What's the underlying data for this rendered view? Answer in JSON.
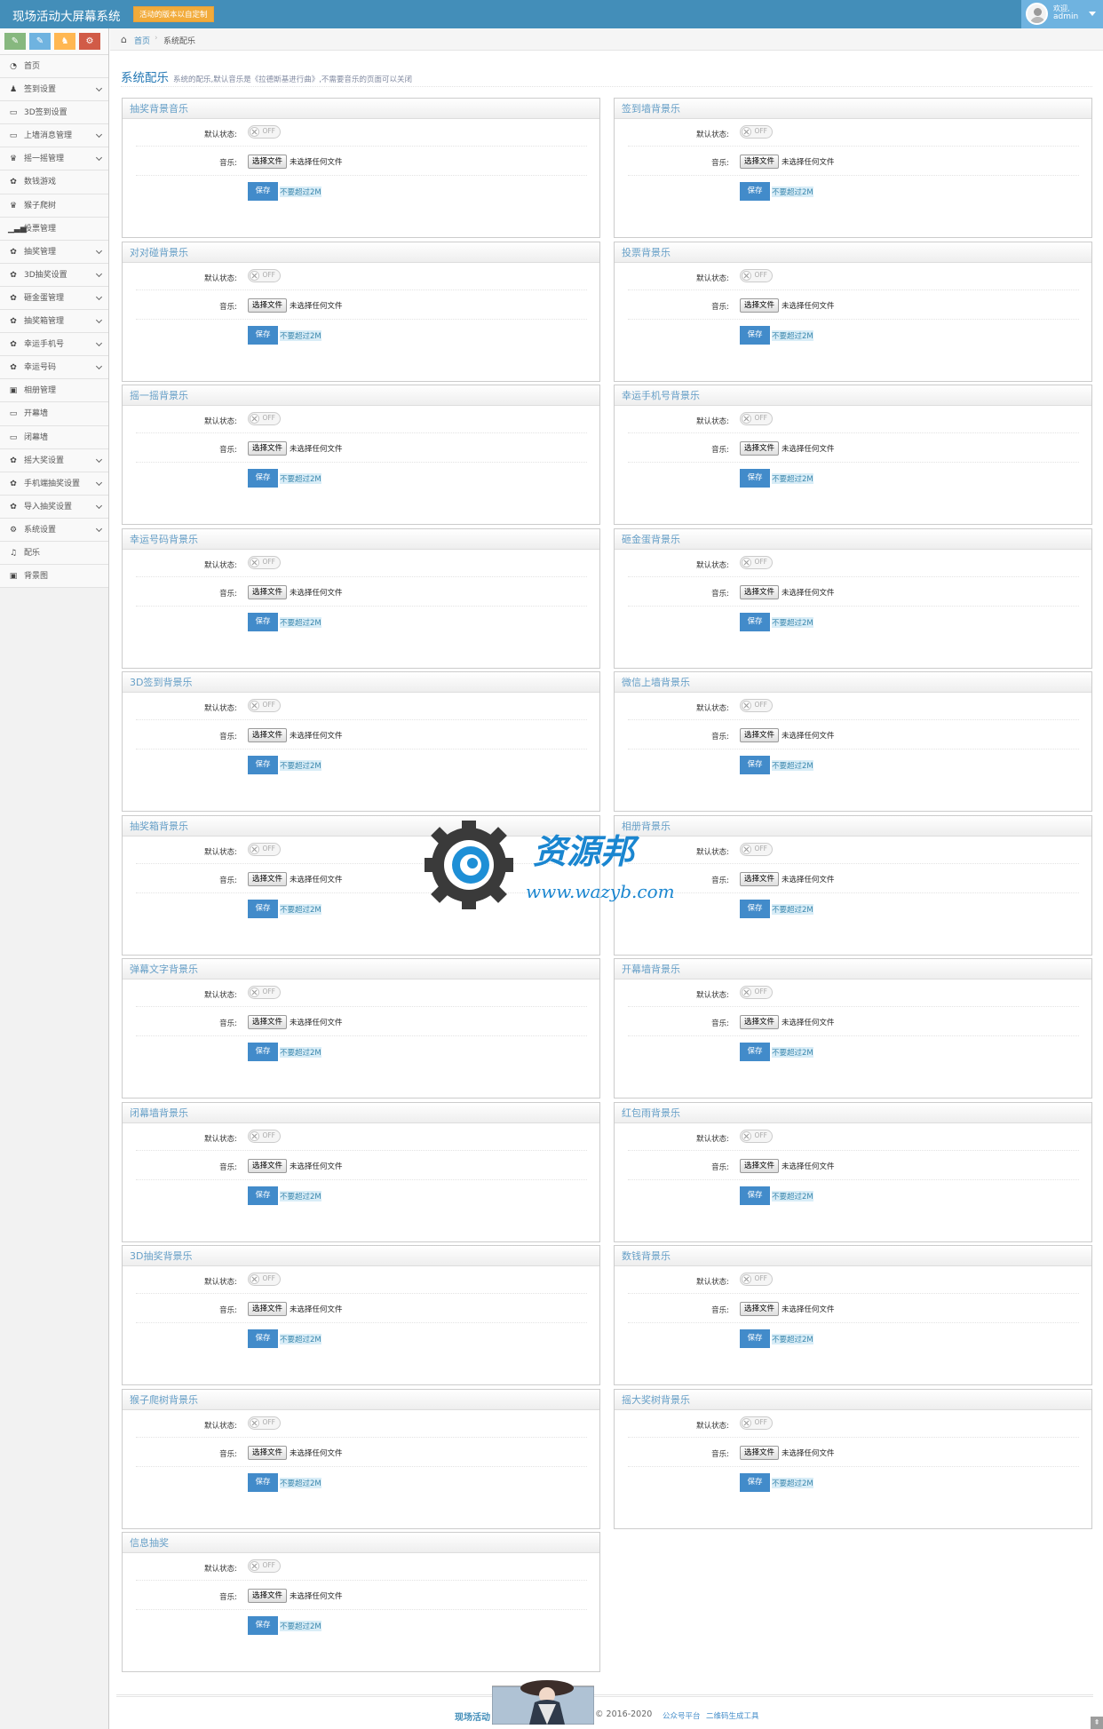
{
  "app": {
    "title": "现场活动大屏幕系统",
    "version_badge": "活动的版本以自定制"
  },
  "user": {
    "welcome": "欢迎,",
    "name": "admin"
  },
  "shortcuts": [
    {
      "icon": "comments-icon",
      "color": "#87b87f",
      "glyph": "✎"
    },
    {
      "icon": "pencil-icon",
      "color": "#6fb3e0",
      "glyph": "✎"
    },
    {
      "icon": "users-icon",
      "color": "#ffb752",
      "glyph": "♞"
    },
    {
      "icon": "cogs-icon",
      "color": "#d15b47",
      "glyph": "⚙"
    }
  ],
  "sidebar": {
    "items": [
      {
        "label": "首页",
        "icon": "dashboard-icon",
        "glyph": "◔",
        "sub": false
      },
      {
        "label": "签到设置",
        "icon": "users-icon",
        "glyph": "♟",
        "sub": true
      },
      {
        "label": "3D签到设置",
        "icon": "desktop-icon",
        "glyph": "▭",
        "sub": false
      },
      {
        "label": "上墙消息管理",
        "icon": "desktop-icon",
        "glyph": "▭",
        "sub": true
      },
      {
        "label": "摇一摇管理",
        "icon": "trophy-icon",
        "glyph": "♛",
        "sub": true
      },
      {
        "label": "数钱游戏",
        "icon": "gift-icon",
        "glyph": "✿",
        "sub": false
      },
      {
        "label": "猴子爬树",
        "icon": "trophy-icon",
        "glyph": "♛",
        "sub": false
      },
      {
        "label": "投票管理",
        "icon": "signal-icon",
        "glyph": "▁▃▅",
        "sub": false
      },
      {
        "label": "抽奖管理",
        "icon": "gift-icon",
        "glyph": "✿",
        "sub": true
      },
      {
        "label": "3D抽奖设置",
        "icon": "gift-icon",
        "glyph": "✿",
        "sub": true
      },
      {
        "label": "砸金蛋管理",
        "icon": "gift-icon",
        "glyph": "✿",
        "sub": true
      },
      {
        "label": "抽奖箱管理",
        "icon": "gift-icon",
        "glyph": "✿",
        "sub": true
      },
      {
        "label": "幸运手机号",
        "icon": "gift-icon",
        "glyph": "✿",
        "sub": true
      },
      {
        "label": "幸运号码",
        "icon": "gift-icon",
        "glyph": "✿",
        "sub": true
      },
      {
        "label": "相册管理",
        "icon": "picture-icon",
        "glyph": "▣",
        "sub": false
      },
      {
        "label": "开幕墙",
        "icon": "desktop-icon",
        "glyph": "▭",
        "sub": false
      },
      {
        "label": "闭幕墙",
        "icon": "desktop-icon",
        "glyph": "▭",
        "sub": false
      },
      {
        "label": "摇大奖设置",
        "icon": "gift-icon",
        "glyph": "✿",
        "sub": true
      },
      {
        "label": "手机端抽奖设置",
        "icon": "gift-icon",
        "glyph": "✿",
        "sub": true
      },
      {
        "label": "导入抽奖设置",
        "icon": "gift-icon",
        "glyph": "✿",
        "sub": true
      },
      {
        "label": "系统设置",
        "icon": "cog-icon",
        "glyph": "⚙",
        "sub": true
      },
      {
        "label": "配乐",
        "icon": "music-icon",
        "glyph": "♫",
        "sub": false
      },
      {
        "label": "背景图",
        "icon": "picture-icon",
        "glyph": "▣",
        "sub": false
      }
    ]
  },
  "breadcrumb": {
    "home": "首页",
    "current": "系统配乐"
  },
  "page": {
    "title": "系统配乐",
    "description": "系统的配乐,默认音乐是《拉德斯基进行曲》,不需要音乐的页面可以关闭"
  },
  "form_labels": {
    "status": "默认状态:",
    "music": "音乐:",
    "choose_file": "选择文件",
    "no_file": "未选择任何文件",
    "save": "保存",
    "hint": "不要超过2M",
    "toggle_off": "OFF"
  },
  "panels": [
    {
      "title": "抽奖背景音乐",
      "enabled": false
    },
    {
      "title": "签到墙背景乐",
      "enabled": false
    },
    {
      "title": "对对碰背景乐",
      "enabled": false
    },
    {
      "title": "投票背景乐",
      "enabled": false
    },
    {
      "title": "摇一摇背景乐",
      "enabled": false
    },
    {
      "title": "幸运手机号背景乐",
      "enabled": false
    },
    {
      "title": "幸运号码背景乐",
      "enabled": false
    },
    {
      "title": "砸金蛋背景乐",
      "enabled": false
    },
    {
      "title": "3D签到背景乐",
      "enabled": false
    },
    {
      "title": "微信上墙背景乐",
      "enabled": false
    },
    {
      "title": "抽奖箱背景乐",
      "enabled": false
    },
    {
      "title": "相册背景乐",
      "enabled": false
    },
    {
      "title": "弹幕文字背景乐",
      "enabled": false
    },
    {
      "title": "开幕墙背景乐",
      "enabled": false
    },
    {
      "title": "闭幕墙背景乐",
      "enabled": false
    },
    {
      "title": "红包雨背景乐",
      "enabled": false
    },
    {
      "title": "3D抽奖背景乐",
      "enabled": false
    },
    {
      "title": "数钱背景乐",
      "enabled": false
    },
    {
      "title": "猴子爬树背景乐",
      "enabled": false
    },
    {
      "title": "摇大奖树背景乐",
      "enabled": false
    },
    {
      "title": "信息抽奖",
      "enabled": false
    }
  ],
  "watermark": {
    "cn": "资源邦",
    "url": "www.wazyb.com"
  },
  "footer": {
    "brand": "现场活动",
    "copyright": "© 2016-2020",
    "links": [
      "公众号平台",
      "二维码生成工具"
    ]
  },
  "colors": {
    "header": "#438eb9",
    "accent": "#428bca",
    "panel_title": "#669fc7"
  }
}
